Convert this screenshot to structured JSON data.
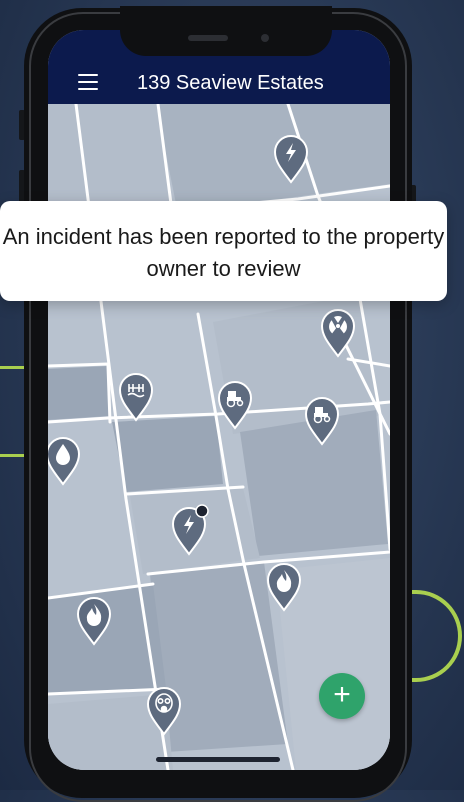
{
  "header": {
    "title": "139 Seaview Estates",
    "menu_icon": "hamburger-menu-icon",
    "background": "#0c1a4d"
  },
  "toast": {
    "message": "An incident has been reported to the property owner to review"
  },
  "fab": {
    "label": "+",
    "icon": "plus-icon",
    "color": "#2fa36b"
  },
  "map": {
    "markers": [
      {
        "type": "lightning",
        "icon": "lightning-icon"
      },
      {
        "type": "radiation",
        "icon": "radiation-icon"
      },
      {
        "type": "water-hazard",
        "icon": "water-hazard-icon"
      },
      {
        "type": "tractor",
        "icon": "tractor-icon"
      },
      {
        "type": "tractor",
        "icon": "tractor-icon"
      },
      {
        "type": "water-drop",
        "icon": "water-drop-icon"
      },
      {
        "type": "lightning",
        "icon": "lightning-icon",
        "badge": true
      },
      {
        "type": "fire",
        "icon": "fire-icon"
      },
      {
        "type": "fire",
        "icon": "fire-icon"
      },
      {
        "type": "gas-mask",
        "icon": "gas-mask-icon"
      }
    ]
  },
  "colors": {
    "accent_line": "#a9cf4f",
    "marker": "#5e6b7f",
    "parcel_dark": "#9aa6b6",
    "parcel_light": "#b8c2cf",
    "road": "#ffffff"
  }
}
